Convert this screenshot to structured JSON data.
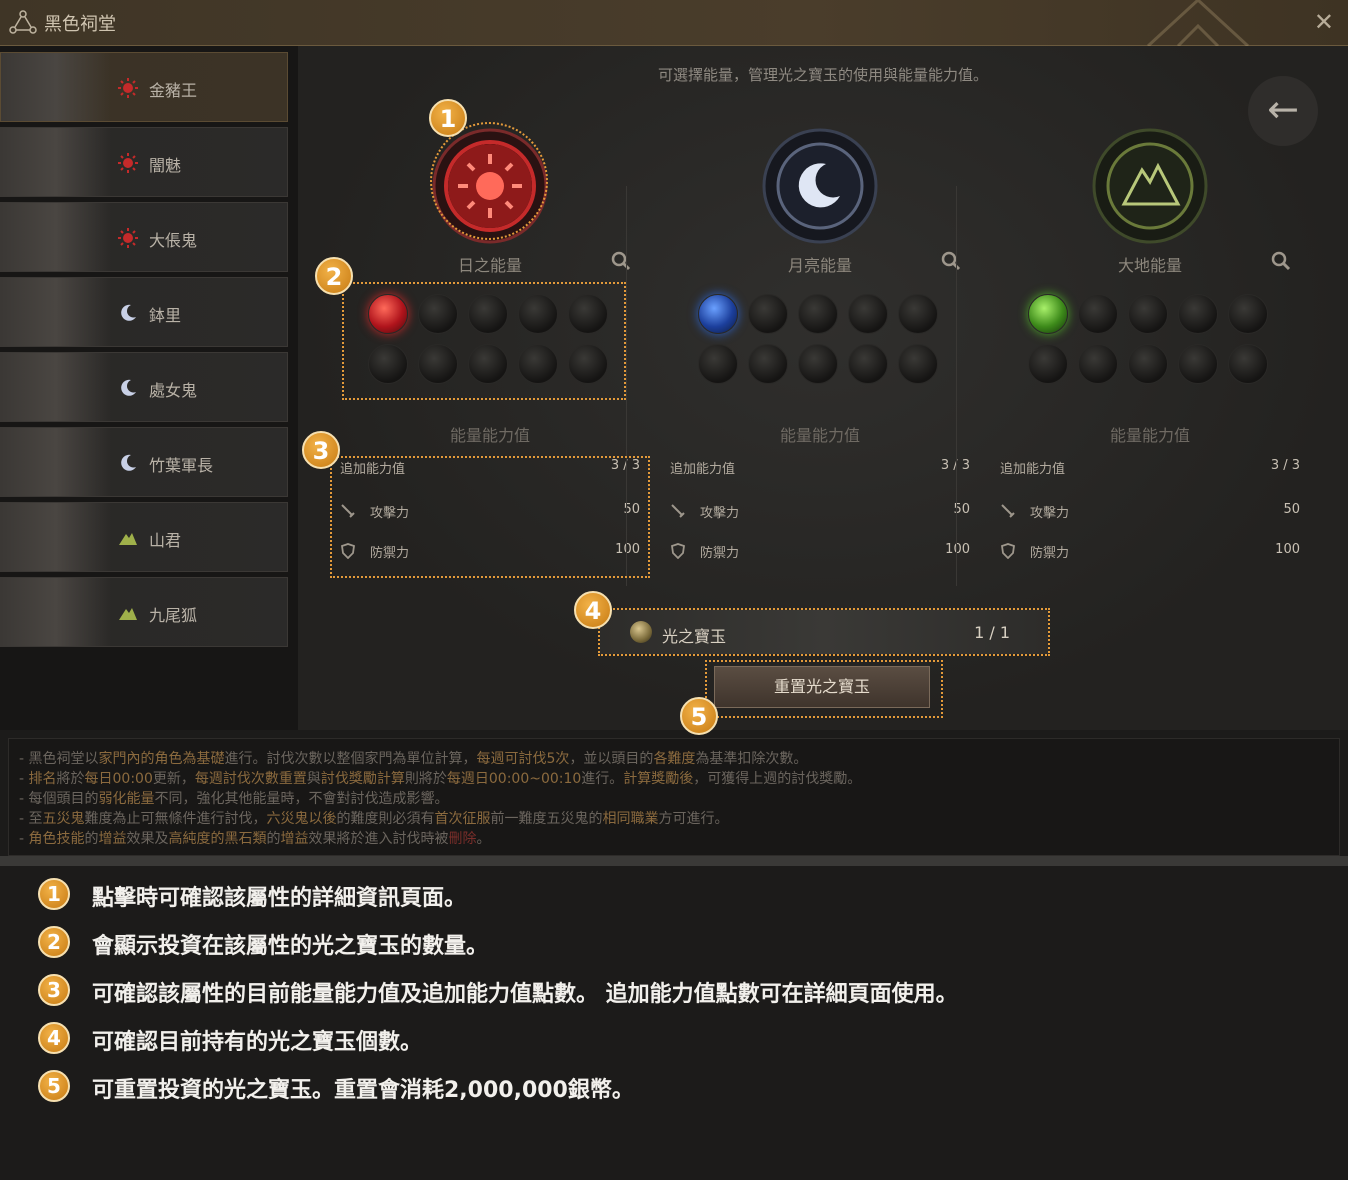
{
  "window": {
    "title": "黑色祠堂"
  },
  "sidebar": {
    "items": [
      {
        "label": "金豬王",
        "type": "sun"
      },
      {
        "label": "闇魅",
        "type": "sun"
      },
      {
        "label": "大倀鬼",
        "type": "sun"
      },
      {
        "label": "鉢里",
        "type": "moon"
      },
      {
        "label": "處女鬼",
        "type": "moon"
      },
      {
        "label": "竹葉軍長",
        "type": "moon"
      },
      {
        "label": "山君",
        "type": "earth"
      },
      {
        "label": "九尾狐",
        "type": "earth"
      }
    ]
  },
  "main": {
    "subtitle": "可選擇能量，管理光之寶玉的使用與能量能力值。",
    "back_icon": "back-arrow-icon",
    "energies": [
      {
        "name": "日之能量",
        "color": "#c52a2a",
        "filled": 1,
        "total": 10,
        "stat_title": "能量能力值",
        "bonus_label": "追加能力值",
        "bonus_value": "3 / 3",
        "attack_label": "攻擊力",
        "attack_value": "50",
        "defense_label": "防禦力",
        "defense_value": "100"
      },
      {
        "name": "月亮能量",
        "color": "#2e62c6",
        "filled": 1,
        "total": 10,
        "stat_title": "能量能力值",
        "bonus_label": "追加能力值",
        "bonus_value": "3 / 3",
        "attack_label": "攻擊力",
        "attack_value": "50",
        "defense_label": "防禦力",
        "defense_value": "100"
      },
      {
        "name": "大地能量",
        "color": "#4fa62a",
        "filled": 1,
        "total": 10,
        "stat_title": "能量能力值",
        "bonus_label": "追加能力值",
        "bonus_value": "3 / 3",
        "attack_label": "攻擊力",
        "attack_value": "50",
        "defense_label": "防禦力",
        "defense_value": "100"
      }
    ],
    "jade": {
      "label": "光之寶玉",
      "count": "1 / 1"
    },
    "reset_button": "重置光之寶玉"
  },
  "callouts": [
    "1",
    "2",
    "3",
    "4",
    "5"
  ],
  "notice": {
    "lines": [
      [
        [
          "- 黑色祠堂以",
          ""
        ],
        [
          "家門內的角色為基礎",
          "hl"
        ],
        [
          "進行。討伐次數以整個家門為單位計算，",
          ""
        ],
        [
          "每週可討伐5次",
          "hl"
        ],
        [
          "，並以頭目的",
          ""
        ],
        [
          "各難度",
          "hl"
        ],
        [
          "為基準扣除次數。",
          ""
        ]
      ],
      [
        [
          "- ",
          ""
        ],
        [
          "排名",
          "hl"
        ],
        [
          "將於",
          ""
        ],
        [
          "每日00:00",
          "hl"
        ],
        [
          "更新，",
          ""
        ],
        [
          "每週討伐次數重置",
          "hl"
        ],
        [
          "與",
          ""
        ],
        [
          "討伐獎勵計算",
          "hl"
        ],
        [
          "則將於",
          ""
        ],
        [
          "每週日00:00~00:10",
          "hl"
        ],
        [
          "進行。",
          ""
        ],
        [
          "計算獎勵後",
          "hl"
        ],
        [
          "，可獲得上週的討伐獎勵。",
          ""
        ]
      ],
      [
        [
          "- 每個頭目的",
          ""
        ],
        [
          "弱化能量",
          "hl"
        ],
        [
          "不同，強化其他能量時，不會對討伐造成影響。",
          ""
        ]
      ],
      [
        [
          "- 至",
          ""
        ],
        [
          "五災鬼",
          "hl"
        ],
        [
          "難度為止可無條件進行討伐，",
          ""
        ],
        [
          "六災鬼以後",
          "hl"
        ],
        [
          "的難度則必須有",
          ""
        ],
        [
          "首次征服",
          "hl"
        ],
        [
          "前一難度五災鬼的",
          ""
        ],
        [
          "相同職業",
          "hl"
        ],
        [
          "方可進行。",
          ""
        ]
      ],
      [
        [
          "- ",
          ""
        ],
        [
          "角色技能",
          "hl"
        ],
        [
          "的",
          ""
        ],
        [
          "增益",
          "hl"
        ],
        [
          "效果及",
          ""
        ],
        [
          "高純度的黑石類",
          "hl"
        ],
        [
          "的",
          ""
        ],
        [
          "增益",
          "hl"
        ],
        [
          "效果將於進入討伐時被",
          ""
        ],
        [
          "刪除",
          "red"
        ],
        [
          "。",
          ""
        ]
      ]
    ]
  },
  "legend": [
    {
      "num": "1",
      "text": "點擊時可確認該屬性的詳細資訊頁面。"
    },
    {
      "num": "2",
      "text": "會顯示投資在該屬性的光之寶玉的數量。"
    },
    {
      "num": "3",
      "text": "可確認該屬性的目前能量能力值及追加能力值點數。 追加能力值點數可在詳細頁面使用。"
    },
    {
      "num": "4",
      "text": "可確認目前持有的光之寶玉個數。"
    },
    {
      "num": "5",
      "text": "可重置投資的光之寶玉。重置會消耗2,000,000銀幣。"
    }
  ]
}
